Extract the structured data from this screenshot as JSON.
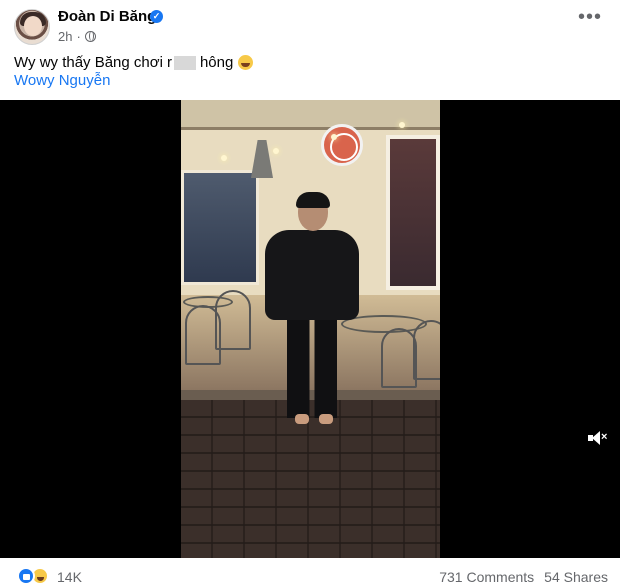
{
  "post": {
    "author": "Đoàn Di Băng",
    "timestamp": "2h",
    "privacy_icon": "globe-icon",
    "verified_icon": "verified-badge-icon",
    "more_label": "•••",
    "caption_before": "Wy wy thấy Băng chơi",
    "caption_partial": "r",
    "caption_after": "hông",
    "caption_emoji": "rolling-on-floor-laughing-emoji",
    "tagged_person": "Wowy Nguyễn"
  },
  "video": {
    "mute_icon": "volume-muted-icon",
    "mute_symbol": "×"
  },
  "footer": {
    "reactions": [
      "like-reaction-icon",
      "haha-reaction-icon"
    ],
    "reaction_count": "14K",
    "comments": "731 Comments",
    "shares": "54 Shares"
  },
  "colors": {
    "link": "#1877f2",
    "secondary_text": "#65676b",
    "video_background": "#000000"
  }
}
